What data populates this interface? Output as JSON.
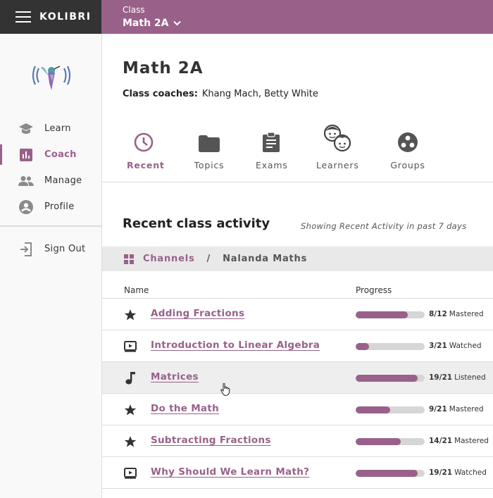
{
  "app": {
    "brand": "KOLIBRI"
  },
  "classbar": {
    "label": "Class",
    "selected": "Math 2A"
  },
  "sidebar": {
    "items": [
      {
        "label": "Learn",
        "icon": "graduation-cap-icon",
        "active": false
      },
      {
        "label": "Coach",
        "icon": "bar-chart-icon",
        "active": true
      },
      {
        "label": "Manage",
        "icon": "people-icon",
        "active": false
      },
      {
        "label": "Profile",
        "icon": "person-circle-icon",
        "active": false
      }
    ],
    "signout": {
      "label": "Sign Out",
      "icon": "sign-out-icon"
    }
  },
  "page": {
    "title": "Math 2A",
    "coaches_label": "Class coaches:",
    "coaches_value": "Khang Mach, Betty White"
  },
  "tabs": [
    {
      "label": "Recent",
      "icon": "clock-icon",
      "active": true
    },
    {
      "label": "Topics",
      "icon": "folder-icon",
      "active": false
    },
    {
      "label": "Exams",
      "icon": "clipboard-icon",
      "active": false
    },
    {
      "label": "Learners",
      "icon": "learners-faces-icon",
      "active": false
    },
    {
      "label": "Groups",
      "icon": "groups-icon",
      "active": false
    }
  ],
  "activity": {
    "title": "Recent class activity",
    "note": "Showing Recent Activity in past 7 days",
    "breadcrumb": {
      "root": "Channels",
      "separator": "/",
      "current": "Nalanda Maths"
    },
    "columns": {
      "name": "Name",
      "progress": "Progress"
    },
    "rows": [
      {
        "kind": "exercise",
        "icon": "star-icon",
        "name": "Adding Fractions",
        "count": "8/12",
        "status": "Mastered",
        "progress": 0.75
      },
      {
        "kind": "video",
        "icon": "video-icon",
        "name": "Introduction to Linear Algebra",
        "count": "3/21",
        "status": "Watched",
        "progress": 0.19
      },
      {
        "kind": "audio",
        "icon": "music-note-icon",
        "name": "Matrices",
        "count": "19/21",
        "status": "Listened",
        "progress": 0.9
      },
      {
        "kind": "exercise",
        "icon": "star-icon",
        "name": "Do the Math",
        "count": "9/21",
        "status": "Mastered",
        "progress": 0.5
      },
      {
        "kind": "exercise",
        "icon": "star-icon",
        "name": "Subtracting Fractions",
        "count": "14/21",
        "status": "Mastered",
        "progress": 0.65
      },
      {
        "kind": "video",
        "icon": "video-icon",
        "name": "Why Should We Learn Math?",
        "count": "19/21",
        "status": "Watched",
        "progress": 0.9
      }
    ]
  },
  "colors": {
    "accent": "#996189",
    "brandbar": "#333333",
    "track": "#d6d6d6"
  }
}
